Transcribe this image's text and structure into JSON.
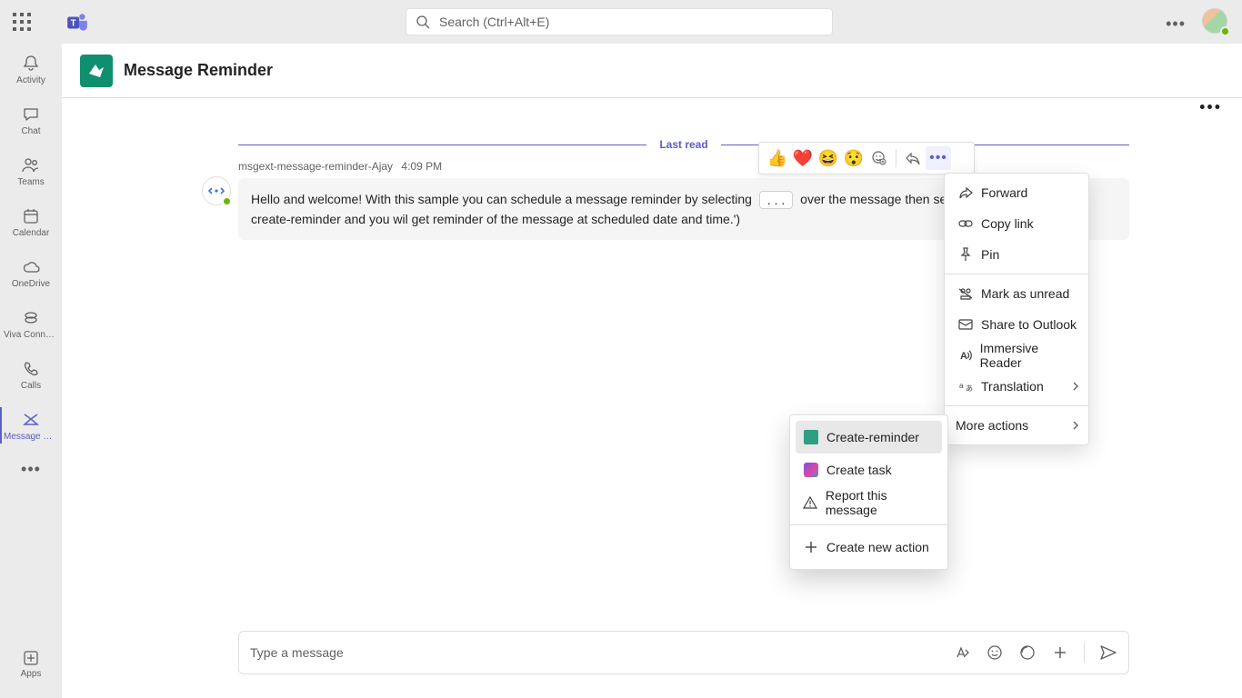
{
  "search": {
    "placeholder": "Search (Ctrl+Alt+E)"
  },
  "rail": {
    "items": [
      {
        "label": "Activity"
      },
      {
        "label": "Chat"
      },
      {
        "label": "Teams"
      },
      {
        "label": "Calendar"
      },
      {
        "label": "OneDrive"
      },
      {
        "label": "Viva Connec..."
      },
      {
        "label": "Calls"
      },
      {
        "label": "Message Re..."
      }
    ],
    "apps": "Apps"
  },
  "header": {
    "title": "Message Reminder"
  },
  "lastread": "Last read",
  "message": {
    "sender": "msgext-message-reminder-Ajay",
    "time": "4:09 PM",
    "body_1": "Hello and welcome! With this sample you can schedule a message reminder by selecting",
    "chip": ". . .",
    "body_2": "over the message then select more action and then create-reminder and you wil get reminder of the message at scheduled date and time.')"
  },
  "reactions": {
    "like": "👍",
    "heart": "❤️",
    "laugh": "😆",
    "surprised": "😯"
  },
  "menu": {
    "forward": "Forward",
    "copylink": "Copy link",
    "pin": "Pin",
    "markunread": "Mark as unread",
    "sharetooutlook": "Share to Outlook",
    "immersive": "Immersive Reader",
    "translation": "Translation",
    "moreactions": "More actions"
  },
  "submenu": {
    "create_reminder": "Create-reminder",
    "create_task": "Create task",
    "report": "Report this message",
    "newaction": "Create new action"
  },
  "compose": {
    "placeholder": "Type a message"
  }
}
